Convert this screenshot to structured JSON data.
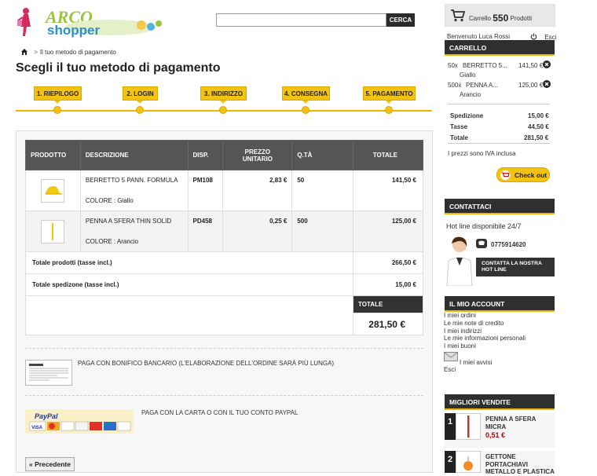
{
  "header": {
    "logo_alt": "Arco shopper",
    "search": {
      "placeholder": "",
      "button": "CERCA"
    },
    "cart": {
      "label_pre": "Carrello",
      "count": "550",
      "label_post": "Prodotti"
    },
    "welcome": "Benvenuto Luca Rossi",
    "logout": "Esci"
  },
  "breadcrumb": {
    "current": "Il tuo metodo di pagamento"
  },
  "page_title": "Scegli il tuo metodo di pagamento",
  "steps": [
    "1. RIEPILOGO",
    "2. LOGIN",
    "3. INDIRIZZO",
    "4. CONSEGNA",
    "5. PAGAMENTO"
  ],
  "table": {
    "headers": [
      "PRODOTTO",
      "DESCRIZIONE",
      "DISP.",
      "PREZZO UNITARIO",
      "Q.TÀ",
      "TOTALE"
    ],
    "rows": [
      {
        "desc": "BERRETTO 5 PANN. FORMULA",
        "color": "COLORE : Giallo",
        "ref": "PM108",
        "unit": "2,83 €",
        "qty": "50",
        "total": "141,50 €"
      },
      {
        "desc": "PENNA A SFERA THIN SOLID",
        "color": "COLORE : Arancio",
        "ref": "PD458",
        "unit": "0,25 €",
        "qty": "500",
        "total": "125,00 €"
      }
    ],
    "totals": [
      {
        "label": "Totale prodotti (tasse incl.)",
        "value": "266,50 €"
      },
      {
        "label": "Totale spedizone (tasse incl.)",
        "value": "15,00 €"
      }
    ],
    "grand_label": "TOTALE",
    "grand_value": "281,50 €"
  },
  "payments": [
    {
      "label": "PAGA CON BONIFICO BANCARIO (L'ELABORAZIONE DELL'ORDINE SARÀ PIÙ LUNGA)"
    },
    {
      "label": "PAGA CON LA CARTA O CON IL TUO CONTO PAYPAL",
      "logo_text": "PayPal",
      "cards": "VISA"
    }
  ],
  "prev_button": "« Precedente",
  "sidebar": {
    "cart_title": "CARRELLO",
    "items": [
      {
        "qty": "50x",
        "name": "BERRETTO 5...",
        "price": "141,50 €",
        "variant": "Giallo"
      },
      {
        "qty": "500x",
        "name": "PENNA A...",
        "price": "125,00 €",
        "variant": "Arancio"
      }
    ],
    "summary": [
      {
        "label": "Spedizione",
        "value": "15,00 €"
      },
      {
        "label": "Tasse",
        "value": "44,50 €"
      },
      {
        "label": "Totale",
        "value": "281,50 €"
      }
    ],
    "vat_note": "I prezzi sono IVA inclusa",
    "checkout": "Check out",
    "contact_title": "CONTATTACI",
    "hotline": "Hot line disponibile 24/7",
    "phone": "0775914620",
    "contact_btn_1": "CONTATTA LA NOSTRA",
    "contact_btn_2": "HOT LINE",
    "account_title": "IL MIO ACCOUNT",
    "account_links": [
      "I miei ordini",
      "Le mie note di credito",
      "I miei indirizzi",
      "Le mie informazioni personali",
      "I miei buoni"
    ],
    "alerts": "I miei avvisi",
    "account_logout": "Esci",
    "best_title": "MIGLIORI VENDITE",
    "best": [
      {
        "num": "1",
        "name1": "PENNA A SFERA",
        "name2": "MICRA",
        "price": "0,51 €"
      },
      {
        "num": "2",
        "name1": "GETTONE",
        "name2": "PORTACHIAVI",
        "name3": "METALLO E PLASTICA"
      }
    ]
  },
  "colors": {
    "accent": "#f4c211",
    "dark": "#2f2f2f",
    "price_red": "#c00000"
  }
}
